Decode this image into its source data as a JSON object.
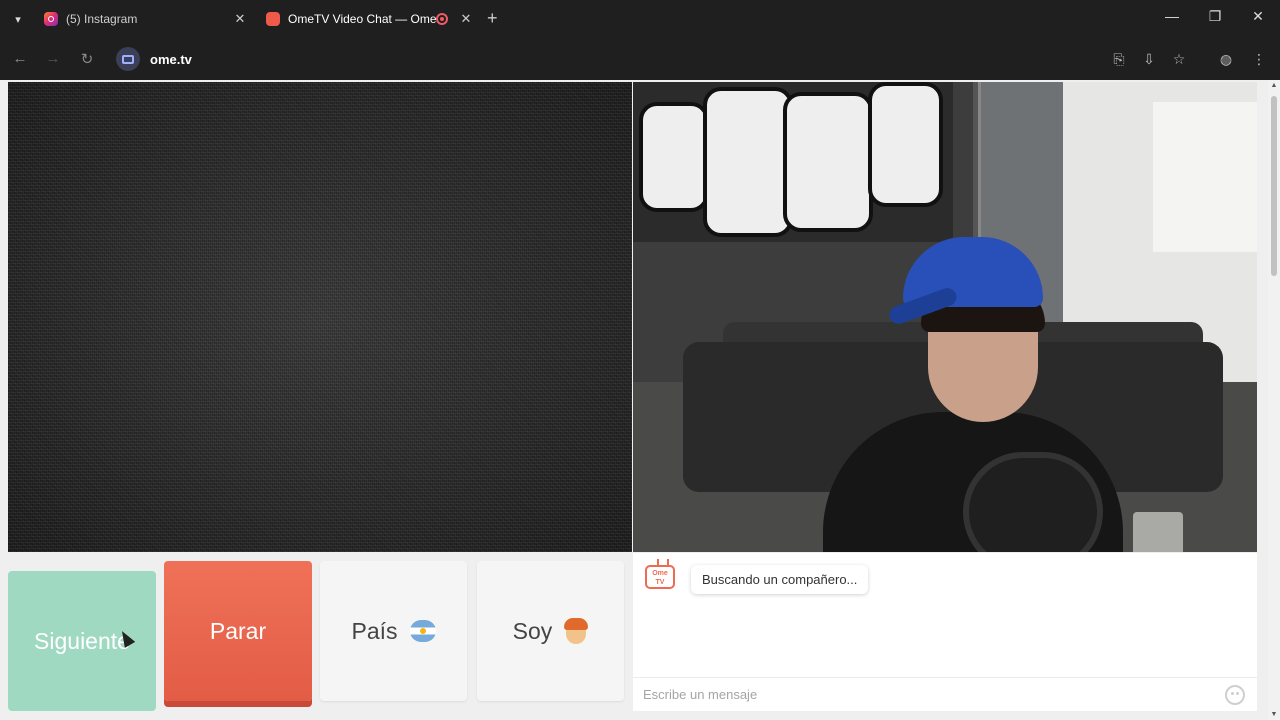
{
  "browser": {
    "tabs": [
      {
        "title": "(5) Instagram",
        "close": "✕"
      },
      {
        "title": "OmeTV Video Chat — Ome",
        "close": "✕"
      }
    ],
    "new_tab": "+",
    "url": "ome.tv",
    "window_controls": {
      "minimize": "—",
      "maximize": "❐",
      "close": "✕"
    }
  },
  "controls": {
    "next_label": "Siguiente",
    "stop_label": "Parar",
    "country_label": "País",
    "gender_label": "Soy"
  },
  "chat": {
    "logo_text": "Ome TV",
    "status_message": "Buscando un compañero...",
    "input_placeholder": "Escribe un mensaje"
  },
  "colors": {
    "next_button": "#9fd9c1",
    "stop_button": "#ef7158",
    "accent": "#ef6a52"
  }
}
